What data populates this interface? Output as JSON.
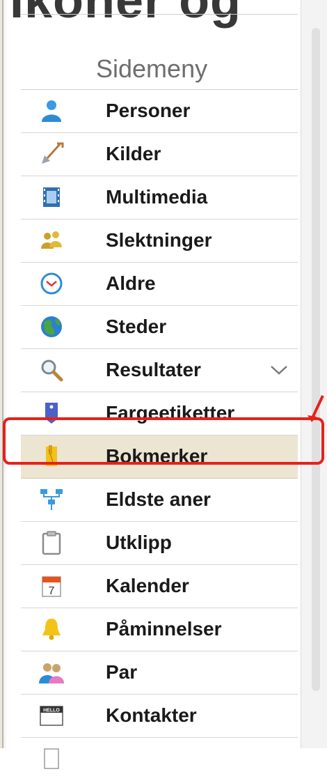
{
  "top_text": "Ikoner og",
  "sidebar": {
    "title": "Sidemeny",
    "items": [
      {
        "label": "Personer",
        "icon": "person-icon"
      },
      {
        "label": "Kilder",
        "icon": "shovel-icon"
      },
      {
        "label": "Multimedia",
        "icon": "film-icon"
      },
      {
        "label": "Slektninger",
        "icon": "relatives-icon"
      },
      {
        "label": "Aldre",
        "icon": "clock-icon"
      },
      {
        "label": "Steder",
        "icon": "globe-icon"
      },
      {
        "label": "Resultater",
        "icon": "magnifier-icon"
      },
      {
        "label": "Fargeetiketter",
        "icon": "label-tag-icon"
      },
      {
        "label": "Bokmerker",
        "icon": "bookmark-icon",
        "selected": true
      },
      {
        "label": "Eldste aner",
        "icon": "ancestor-tree-icon"
      },
      {
        "label": "Utklipp",
        "icon": "clipboard-icon"
      },
      {
        "label": "Kalender",
        "icon": "calendar-icon"
      },
      {
        "label": "Påminnelser",
        "icon": "bell-icon"
      },
      {
        "label": "Par",
        "icon": "couple-icon"
      },
      {
        "label": "Kontakter",
        "icon": "hello-badge-icon"
      }
    ]
  },
  "calendar_day": "7",
  "hello_text": "HELLO",
  "colors": {
    "highlight": "#e8201a",
    "selected_bg": "#ebe5d1"
  }
}
